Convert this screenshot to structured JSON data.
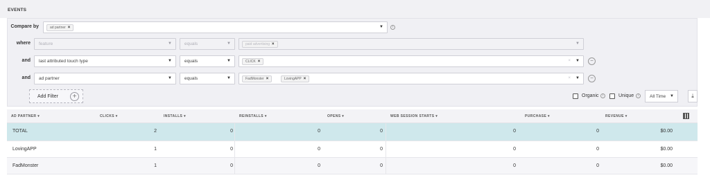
{
  "section_title": "EVENTS",
  "compare": {
    "label": "Compare by",
    "tag": "ad partner"
  },
  "filters": [
    {
      "connector": "where",
      "field": "feature",
      "operator": "equals",
      "values": [
        "paid advertising"
      ],
      "disabled": true
    },
    {
      "connector": "and",
      "field": "last attributed touch type",
      "operator": "equals",
      "values": [
        "CLICK"
      ],
      "disabled": false
    },
    {
      "connector": "and",
      "field": "ad partner",
      "operator": "equals",
      "values": [
        "FadMonster",
        "LovingAPP"
      ],
      "disabled": false
    }
  ],
  "add_filter_label": "Add Filter",
  "options": {
    "organic_label": "Organic",
    "unique_label": "Unique",
    "time_range": "All Time"
  },
  "table": {
    "columns": [
      "AD PARTNER",
      "CLICKS",
      "INSTALLS",
      "REINSTALLS",
      "OPENS",
      "WEB SESSION STARTS",
      "PURCHASE",
      "REVENUE"
    ],
    "rows": [
      {
        "name": "TOTAL",
        "clicks": "2",
        "installs": "0",
        "reinstalls": "0",
        "opens": "0",
        "web_session_starts": "0",
        "purchase": "0",
        "revenue": "$0.00"
      },
      {
        "name": "LovingAPP",
        "clicks": "1",
        "installs": "0",
        "reinstalls": "0",
        "opens": "0",
        "web_session_starts": "0",
        "purchase": "0",
        "revenue": "$0.00"
      },
      {
        "name": "FadMonster",
        "clicks": "1",
        "installs": "0",
        "reinstalls": "0",
        "opens": "0",
        "web_session_starts": "0",
        "purchase": "0",
        "revenue": "$0.00"
      }
    ]
  },
  "colors": {
    "total_row": "#cfe8ec",
    "panel": "#f0f0f4"
  },
  "icons": [
    "info-icon",
    "remove-tag-icon",
    "chevron-down-icon",
    "minus-circle-icon",
    "plus-circle-icon",
    "download-icon",
    "columns-icon"
  ]
}
